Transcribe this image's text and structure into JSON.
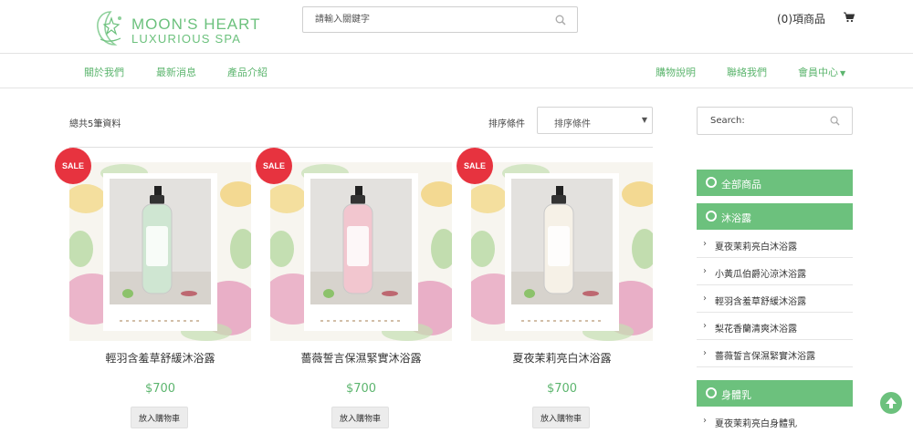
{
  "brand": {
    "name": "MOON'S HEART",
    "subtitle": "LUXURIOUS SPA"
  },
  "header": {
    "search_placeholder": "請輸入關鍵字",
    "cart_label": "(0)項商品"
  },
  "nav": {
    "left": [
      "關於我們",
      "最新消息",
      "產品介紹"
    ],
    "right": [
      "購物說明",
      "聯絡我們",
      "會員中心"
    ]
  },
  "listing": {
    "total_text": "總共5筆資料",
    "sort_label": "排序條件",
    "sort_selected": "排序條件"
  },
  "products": [
    {
      "badge": "SALE",
      "name": "輕羽含羞草舒緩沐浴露",
      "price": "$700",
      "button": "放入購物車",
      "bottle_color": "#cfe6d2"
    },
    {
      "badge": "SALE",
      "name": "薔薇誓言保濕緊實沐浴露",
      "price": "$700",
      "button": "放入購物車",
      "bottle_color": "#f2c6cf"
    },
    {
      "badge": "SALE",
      "name": "夏夜茉莉亮白沐浴露",
      "price": "$700",
      "button": "放入購物車",
      "bottle_color": "#f6f1e7"
    }
  ],
  "sidebar": {
    "search_placeholder": "Search:",
    "categories": [
      {
        "label": "全部商品",
        "children": []
      },
      {
        "label": "沐浴露",
        "children": [
          "夏夜茉莉亮白沐浴露",
          "小黃瓜伯爵沁涼沐浴露",
          "輕羽含羞草舒緩沐浴露",
          "梨花香蘭清爽沐浴露",
          "薔薇誓言保濕緊實沐浴露"
        ]
      },
      {
        "label": "身體乳",
        "children": [
          "夏夜茉莉亮白身體乳"
        ]
      }
    ]
  },
  "colors": {
    "accent": "#6cc17d",
    "sale": "#e7333f"
  }
}
